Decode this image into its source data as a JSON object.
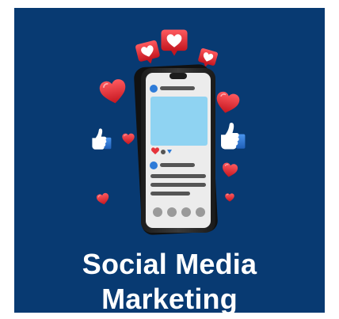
{
  "title": {
    "line1": "Social Media",
    "line2": "Marketing"
  },
  "colors": {
    "background": "#083A72",
    "heart": "#E6333B",
    "screen_card": "#8FD3F2",
    "like_thumb": "#2E7BD8",
    "phone_frame": "#2B2B2B",
    "text": "#FFFFFF"
  },
  "icons": [
    "phone-icon",
    "heart-icon",
    "heart-speech-bubble-icon",
    "thumbs-up-icon"
  ]
}
